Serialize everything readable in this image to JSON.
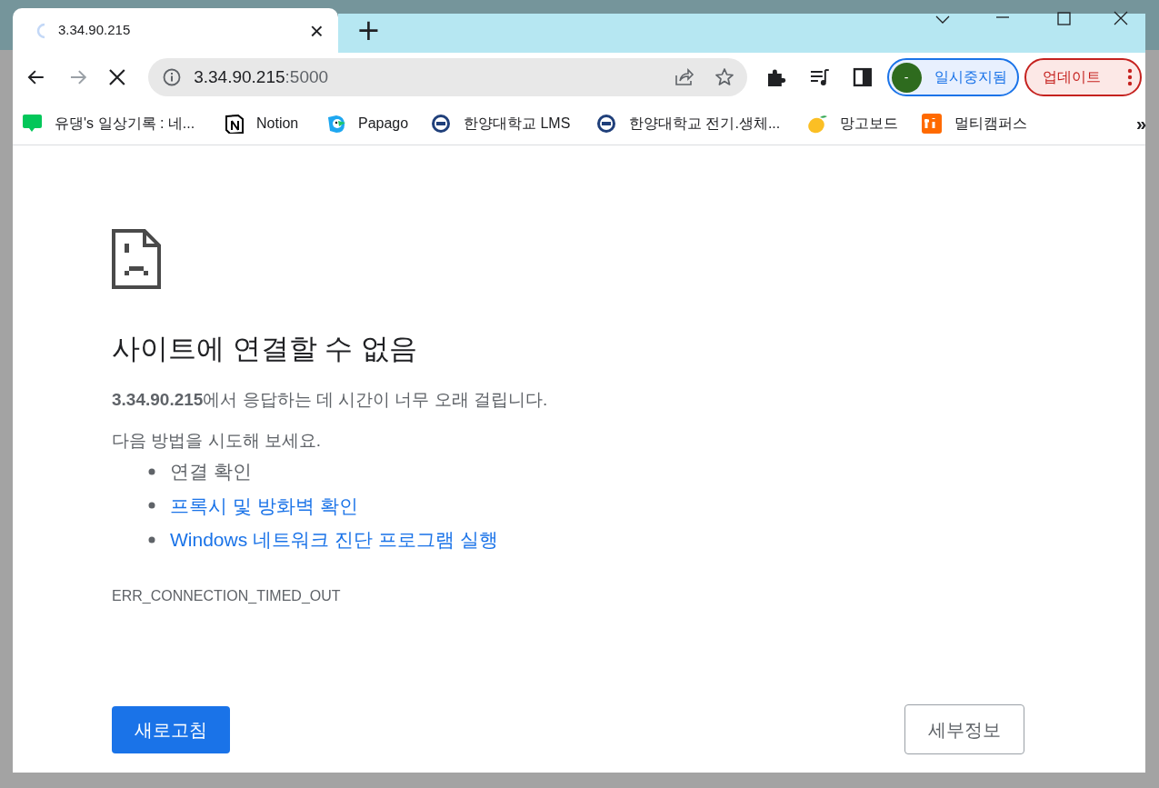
{
  "tab": {
    "title": "3.34.90.215",
    "close": "×",
    "loading": true
  },
  "new_tab": "+",
  "toolbar": {
    "address_host": "3.34.90.215",
    "address_port": ":5000",
    "profile": {
      "avatar": "-",
      "label": "일시중지됨"
    },
    "update_button": "업데이트"
  },
  "bookmarks": [
    {
      "label": "유댕's 일상기록 : 네..."
    },
    {
      "label": "Notion"
    },
    {
      "label": "Papago"
    },
    {
      "label": "한양대학교 LMS"
    },
    {
      "label": "한양대학교 전기.생체..."
    },
    {
      "label": "망고보드"
    },
    {
      "label": "멀티캠퍼스"
    }
  ],
  "bookmarks_more": "»",
  "error": {
    "title": "사이트에 연결할 수 없음",
    "message": "**3.34.90.215**에서 응답하는 데 시간이 너무 오래 걸립니다.",
    "try_heading": "다음 방법을 시도해 보세요.",
    "suggestions": [
      {
        "kind": "text",
        "label": "연결 확인"
      },
      {
        "kind": "link",
        "label": "프록시 및 방화벽 확인"
      },
      {
        "kind": "link",
        "label": "Windows 네트워크 진단 프로그램 실행"
      }
    ],
    "code": "ERR_CONNECTION_TIMED_OUT",
    "reload_button": "새로고침",
    "details_button": "세부정보"
  }
}
